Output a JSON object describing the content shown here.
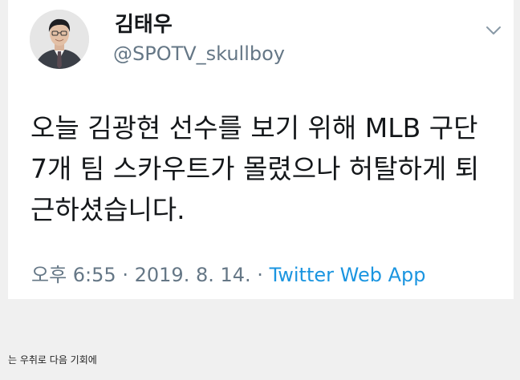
{
  "tweet": {
    "display_name": "김태우",
    "handle": "@SPOTV_skullboy",
    "text": "오늘 김광현 선수를 보기 위해 MLB 구단\n7개 팀 스카우트가 몰렸으나 허탈하게 퇴\n근하셨습니다.",
    "time": "오후 6:55",
    "date": "2019. 8. 14.",
    "separator": "·",
    "source": "Twitter Web App",
    "icons": [
      "avatar-photo",
      "chevron-down-icon"
    ],
    "colors": {
      "text": "#14171a",
      "secondary": "#657786",
      "link": "#1b95e0"
    }
  },
  "caption": "는 우취로 다음 기회에"
}
